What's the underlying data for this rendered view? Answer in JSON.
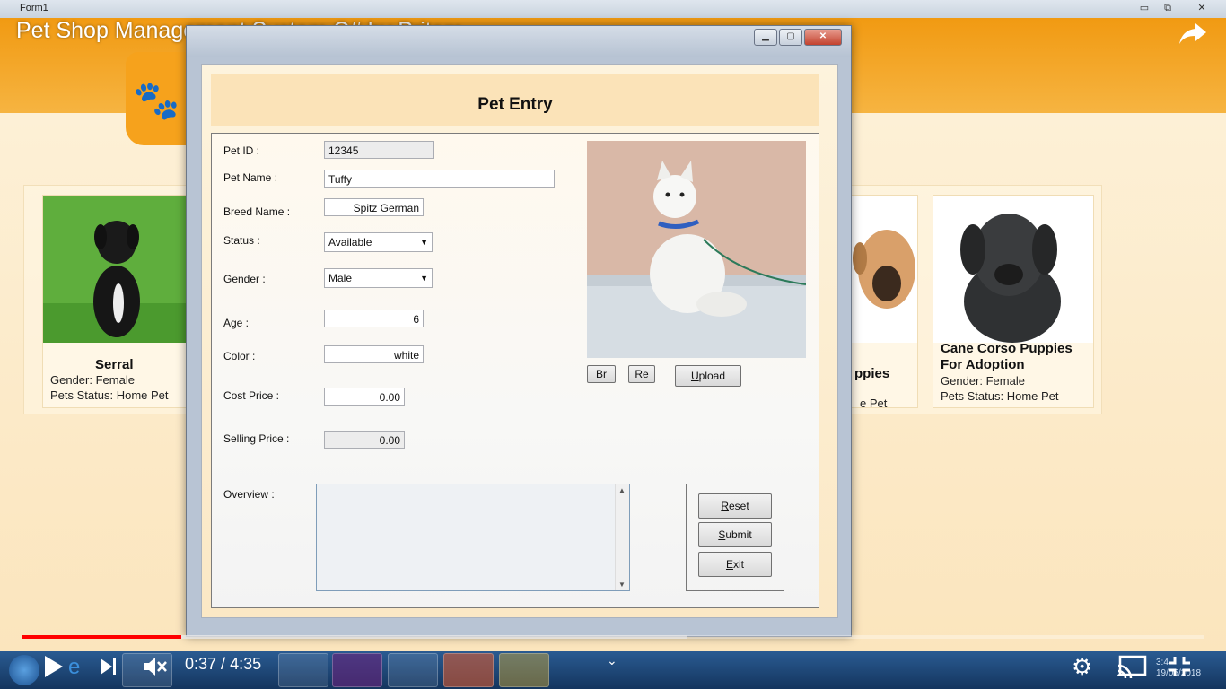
{
  "background_form": {
    "window_title": "Form1",
    "cards": [
      {
        "name": "Serral",
        "gender": "Gender: Female",
        "status": "Pets Status: Home Pet"
      },
      {
        "name": "ppies",
        "status": "e Pet"
      },
      {
        "name": "Cane Corso Puppies For Adoption",
        "gender": "Gender: Female",
        "status": "Pets Status: Home Pet"
      }
    ]
  },
  "video": {
    "title": "Pet Shop Management System C# by Pritam",
    "time_current": "0:37",
    "time_separator": " / ",
    "time_total": "4:35",
    "progress": 0.135
  },
  "dialog": {
    "form_title": "Pet Entry",
    "labels": {
      "pet_id": "Pet ID :",
      "pet_name": "Pet Name :",
      "breed_name": "Breed Name :",
      "status": "Status :",
      "gender": "Gender :",
      "age": "Age :",
      "color": "Color :",
      "cost_price": "Cost Price :",
      "selling_price": "Selling Price :",
      "overview": "Overview :"
    },
    "values": {
      "pet_id": "12345",
      "pet_name": "Tuffy",
      "breed_name": "Spitz German",
      "status": "Available",
      "gender": "Male",
      "age": "6",
      "color": "white",
      "cost_price": "0.00",
      "selling_price": "0.00",
      "overview": ""
    },
    "buttons": {
      "browse": "Br",
      "remove": "Re",
      "upload_first": "U",
      "upload_rest": "pload",
      "reset_first": "R",
      "reset_rest": "eset",
      "submit_first": "S",
      "submit_rest": "ubmit",
      "exit_first": "E",
      "exit_rest": "xit"
    }
  },
  "clock": {
    "time": "3:4",
    "date": "19/05/2018"
  },
  "colors": {
    "header_orange": "#f19a12",
    "form_bg": "#fdf3dd",
    "progress_red": "#ff0000",
    "taskbar_blue": "#1f4a7d"
  }
}
